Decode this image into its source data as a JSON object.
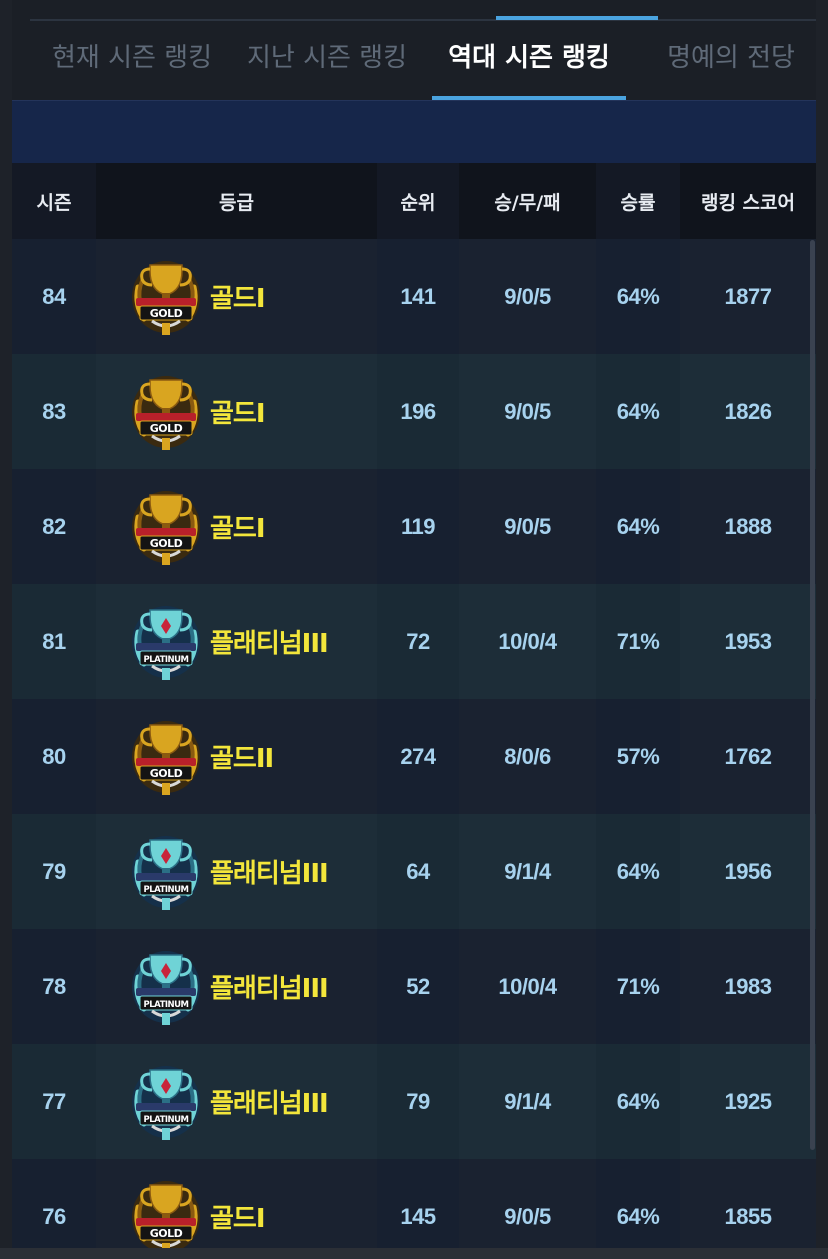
{
  "tabs": [
    {
      "label": "현재 시즌 랭킹",
      "active": false
    },
    {
      "label": "지난 시즌 랭킹",
      "active": false
    },
    {
      "label": "역대 시즌 랭킹",
      "active": true
    },
    {
      "label": "명예의 전당",
      "active": false
    }
  ],
  "table": {
    "headers": {
      "season": "시즌",
      "grade": "등급",
      "rank": "순위",
      "wld": "승/무/패",
      "rate": "승률",
      "score": "랭킹 스코어"
    },
    "rows": [
      {
        "season": "84",
        "badge": "gold-trophy-icon",
        "grade": "골드I",
        "rank": "141",
        "wld": "9/0/5",
        "rate": "64%",
        "score": "1877"
      },
      {
        "season": "83",
        "badge": "gold-trophy-icon",
        "grade": "골드I",
        "rank": "196",
        "wld": "9/0/5",
        "rate": "64%",
        "score": "1826"
      },
      {
        "season": "82",
        "badge": "gold-trophy-icon",
        "grade": "골드I",
        "rank": "119",
        "wld": "9/0/5",
        "rate": "64%",
        "score": "1888"
      },
      {
        "season": "81",
        "badge": "platinum-trophy-icon",
        "grade": "플래티넘III",
        "rank": "72",
        "wld": "10/0/4",
        "rate": "71%",
        "score": "1953"
      },
      {
        "season": "80",
        "badge": "gold-trophy-icon",
        "grade": "골드II",
        "rank": "274",
        "wld": "8/0/6",
        "rate": "57%",
        "score": "1762"
      },
      {
        "season": "79",
        "badge": "platinum-trophy-icon",
        "grade": "플래티넘III",
        "rank": "64",
        "wld": "9/1/4",
        "rate": "64%",
        "score": "1956"
      },
      {
        "season": "78",
        "badge": "platinum-trophy-icon",
        "grade": "플래티넘III",
        "rank": "52",
        "wld": "10/0/4",
        "rate": "71%",
        "score": "1983"
      },
      {
        "season": "77",
        "badge": "platinum-trophy-icon",
        "grade": "플래티넘III",
        "rank": "79",
        "wld": "9/1/4",
        "rate": "64%",
        "score": "1925"
      },
      {
        "season": "76",
        "badge": "gold-trophy-icon",
        "grade": "골드I",
        "rank": "145",
        "wld": "9/0/5",
        "rate": "64%",
        "score": "1855"
      }
    ]
  },
  "badges": {
    "gold-trophy-icon": {
      "text": "GOLD",
      "primary": "#d9a520",
      "secondary": "#8a5a10",
      "ribbon": "#b8202a"
    },
    "platinum-trophy-icon": {
      "text": "PLATINUM",
      "primary": "#6fd3d6",
      "secondary": "#2b6f86",
      "ribbon": "#2a3a6a"
    }
  },
  "colors": {
    "accent": "#4aa3df",
    "grade_text": "#f3e63b",
    "cell_text": "#a7d2ee",
    "banner": "#16264a"
  }
}
